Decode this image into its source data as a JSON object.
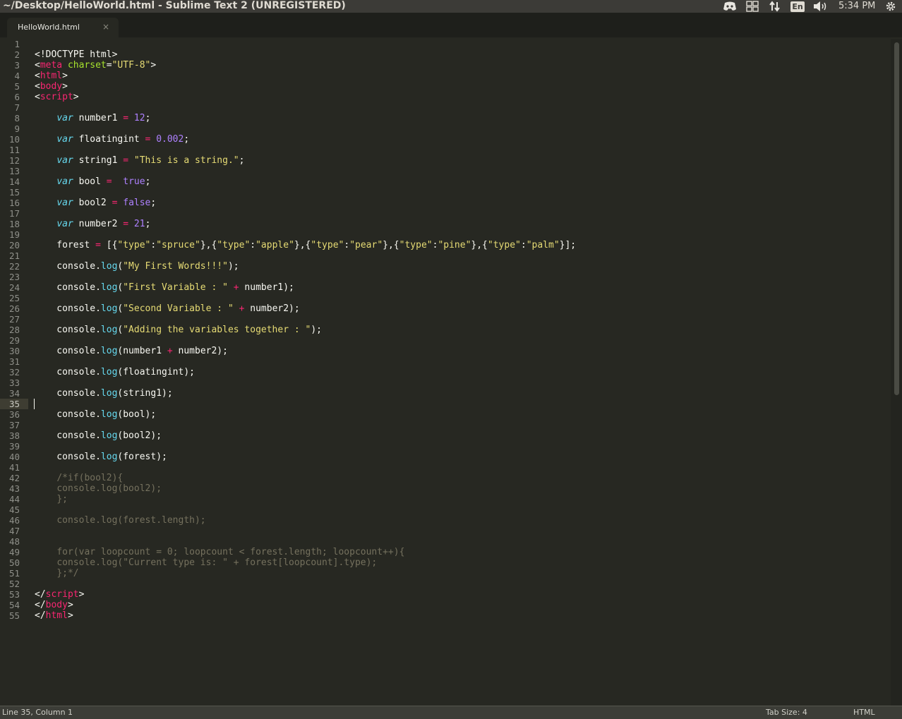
{
  "window": {
    "title": "~/Desktop/HelloWorld.html - Sublime Text 2 (UNREGISTERED)"
  },
  "tray": {
    "icons": [
      "discord-icon",
      "workspace-switcher-icon",
      "network-arrows-icon",
      "keyboard-layout-icon",
      "volume-icon",
      "session-gear-icon"
    ],
    "keyboard_layout": "En",
    "clock": "5:34 PM"
  },
  "tabs": [
    {
      "label": "HelloWorld.html",
      "close": "×"
    }
  ],
  "editor": {
    "current_line": 35,
    "line_numbers": [
      "1",
      "2",
      "3",
      "4",
      "5",
      "6",
      "7",
      "8",
      "9",
      "10",
      "11",
      "12",
      "13",
      "14",
      "15",
      "16",
      "17",
      "18",
      "19",
      "20",
      "21",
      "22",
      "23",
      "24",
      "25",
      "26",
      "27",
      "28",
      "29",
      "30",
      "31",
      "32",
      "33",
      "34",
      "35",
      "36",
      "37",
      "38",
      "39",
      "40",
      "41",
      "42",
      "43",
      "44",
      "45",
      "46",
      "47",
      "48",
      "49",
      "50",
      "51",
      "52",
      "53",
      "54",
      "55"
    ],
    "lines": [
      [],
      [
        [
          "",
          "<!DOCTYPE html>"
        ]
      ],
      [
        [
          "",
          "<"
        ],
        [
          "t",
          "meta"
        ],
        [
          "",
          " "
        ],
        [
          "a",
          "charset"
        ],
        [
          "",
          "="
        ],
        [
          "s",
          "\"UTF-8\""
        ],
        [
          "",
          ">"
        ]
      ],
      [
        [
          "",
          "<"
        ],
        [
          "t",
          "html"
        ],
        [
          "",
          ">"
        ]
      ],
      [
        [
          "",
          "<"
        ],
        [
          "t",
          "body"
        ],
        [
          "",
          ">"
        ]
      ],
      [
        [
          "",
          "<"
        ],
        [
          "t",
          "script"
        ],
        [
          "",
          ">"
        ]
      ],
      [],
      [
        [
          "",
          "    "
        ],
        [
          "k",
          "var"
        ],
        [
          "",
          " number1 "
        ],
        [
          "o",
          "="
        ],
        [
          "",
          " "
        ],
        [
          "n",
          "12"
        ],
        [
          "",
          ";"
        ]
      ],
      [],
      [
        [
          "",
          "    "
        ],
        [
          "k",
          "var"
        ],
        [
          "",
          " floatingint "
        ],
        [
          "o",
          "="
        ],
        [
          "",
          " "
        ],
        [
          "n",
          "0.002"
        ],
        [
          "",
          ";"
        ]
      ],
      [],
      [
        [
          "",
          "    "
        ],
        [
          "k",
          "var"
        ],
        [
          "",
          " string1 "
        ],
        [
          "o",
          "="
        ],
        [
          "",
          " "
        ],
        [
          "s",
          "\"This is a string.\""
        ],
        [
          "",
          ";"
        ]
      ],
      [],
      [
        [
          "",
          "    "
        ],
        [
          "k",
          "var"
        ],
        [
          "",
          " bool "
        ],
        [
          "o",
          "="
        ],
        [
          "",
          "  "
        ],
        [
          "n",
          "true"
        ],
        [
          "",
          ";"
        ]
      ],
      [],
      [
        [
          "",
          "    "
        ],
        [
          "k",
          "var"
        ],
        [
          "",
          " bool2 "
        ],
        [
          "o",
          "="
        ],
        [
          "",
          " "
        ],
        [
          "n",
          "false"
        ],
        [
          "",
          ";"
        ]
      ],
      [],
      [
        [
          "",
          "    "
        ],
        [
          "k",
          "var"
        ],
        [
          "",
          " number2 "
        ],
        [
          "o",
          "="
        ],
        [
          "",
          " "
        ],
        [
          "n",
          "21"
        ],
        [
          "",
          ";"
        ]
      ],
      [],
      [
        [
          "",
          "    forest "
        ],
        [
          "o",
          "="
        ],
        [
          "",
          " [{"
        ],
        [
          "s",
          "\"type\""
        ],
        [
          "",
          ":"
        ],
        [
          "s",
          "\"spruce\""
        ],
        [
          "",
          "},{"
        ],
        [
          "s",
          "\"type\""
        ],
        [
          "",
          ":"
        ],
        [
          "s",
          "\"apple\""
        ],
        [
          "",
          "},{"
        ],
        [
          "s",
          "\"type\""
        ],
        [
          "",
          ":"
        ],
        [
          "s",
          "\"pear\""
        ],
        [
          "",
          "},{"
        ],
        [
          "s",
          "\"type\""
        ],
        [
          "",
          ":"
        ],
        [
          "s",
          "\"pine\""
        ],
        [
          "",
          "},{"
        ],
        [
          "s",
          "\"type\""
        ],
        [
          "",
          ":"
        ],
        [
          "s",
          "\"palm\""
        ],
        [
          "",
          "}];"
        ]
      ],
      [],
      [
        [
          "",
          "    console."
        ],
        [
          "f",
          "log"
        ],
        [
          "",
          "("
        ],
        [
          "s",
          "\"My First Words!!!\""
        ],
        [
          "",
          ");"
        ]
      ],
      [],
      [
        [
          "",
          "    console."
        ],
        [
          "f",
          "log"
        ],
        [
          "",
          "("
        ],
        [
          "s",
          "\"First Variable : \""
        ],
        [
          "",
          " "
        ],
        [
          "o",
          "+"
        ],
        [
          "",
          " number1);"
        ]
      ],
      [],
      [
        [
          "",
          "    console."
        ],
        [
          "f",
          "log"
        ],
        [
          "",
          "("
        ],
        [
          "s",
          "\"Second Variable : \""
        ],
        [
          "",
          " "
        ],
        [
          "o",
          "+"
        ],
        [
          "",
          " number2);"
        ]
      ],
      [],
      [
        [
          "",
          "    console."
        ],
        [
          "f",
          "log"
        ],
        [
          "",
          "("
        ],
        [
          "s",
          "\"Adding the variables together : \""
        ],
        [
          "",
          ");"
        ]
      ],
      [],
      [
        [
          "",
          "    console."
        ],
        [
          "f",
          "log"
        ],
        [
          "",
          "(number1 "
        ],
        [
          "o",
          "+"
        ],
        [
          "",
          " number2);"
        ]
      ],
      [],
      [
        [
          "",
          "    console."
        ],
        [
          "f",
          "log"
        ],
        [
          "",
          "(floatingint);"
        ]
      ],
      [],
      [
        [
          "",
          "    console."
        ],
        [
          "f",
          "log"
        ],
        [
          "",
          "(string1);"
        ]
      ],
      [],
      [
        [
          "",
          "    console."
        ],
        [
          "f",
          "log"
        ],
        [
          "",
          "(bool);"
        ]
      ],
      [],
      [
        [
          "",
          "    console."
        ],
        [
          "f",
          "log"
        ],
        [
          "",
          "(bool2);"
        ]
      ],
      [],
      [
        [
          "",
          "    console."
        ],
        [
          "f",
          "log"
        ],
        [
          "",
          "(forest);"
        ]
      ],
      [],
      [
        [
          "",
          "    "
        ],
        [
          "c",
          "/*if(bool2){"
        ]
      ],
      [
        [
          "",
          "    "
        ],
        [
          "c",
          "console.log(bool2);"
        ]
      ],
      [
        [
          "",
          "    "
        ],
        [
          "c",
          "};"
        ]
      ],
      [],
      [
        [
          "",
          "    "
        ],
        [
          "c",
          "console.log(forest.length);"
        ]
      ],
      [],
      [],
      [
        [
          "",
          "    "
        ],
        [
          "c",
          "for(var loopcount = 0; loopcount < forest.length; loopcount++){"
        ]
      ],
      [
        [
          "",
          "    "
        ],
        [
          "c",
          "console.log(\"Current type is: \" + forest[loopcount].type);"
        ]
      ],
      [
        [
          "",
          "    "
        ],
        [
          "c",
          "};*/"
        ]
      ],
      [],
      [
        [
          "",
          "</"
        ],
        [
          "t",
          "script"
        ],
        [
          "",
          ">"
        ]
      ],
      [
        [
          "",
          "</"
        ],
        [
          "t",
          "body"
        ],
        [
          "",
          ">"
        ]
      ],
      [
        [
          "",
          "</"
        ],
        [
          "t",
          "html"
        ],
        [
          "",
          ">"
        ]
      ]
    ]
  },
  "statusbar": {
    "position": "Line 35, Column 1",
    "tab_size": "Tab Size: 4",
    "syntax": "HTML"
  },
  "colors": {
    "background": "#272822",
    "tag": "#f92672",
    "attribute": "#a6e22e",
    "string": "#e6db74",
    "keyword": "#66d9ef",
    "number": "#ae81ff",
    "comment": "#75715e"
  }
}
